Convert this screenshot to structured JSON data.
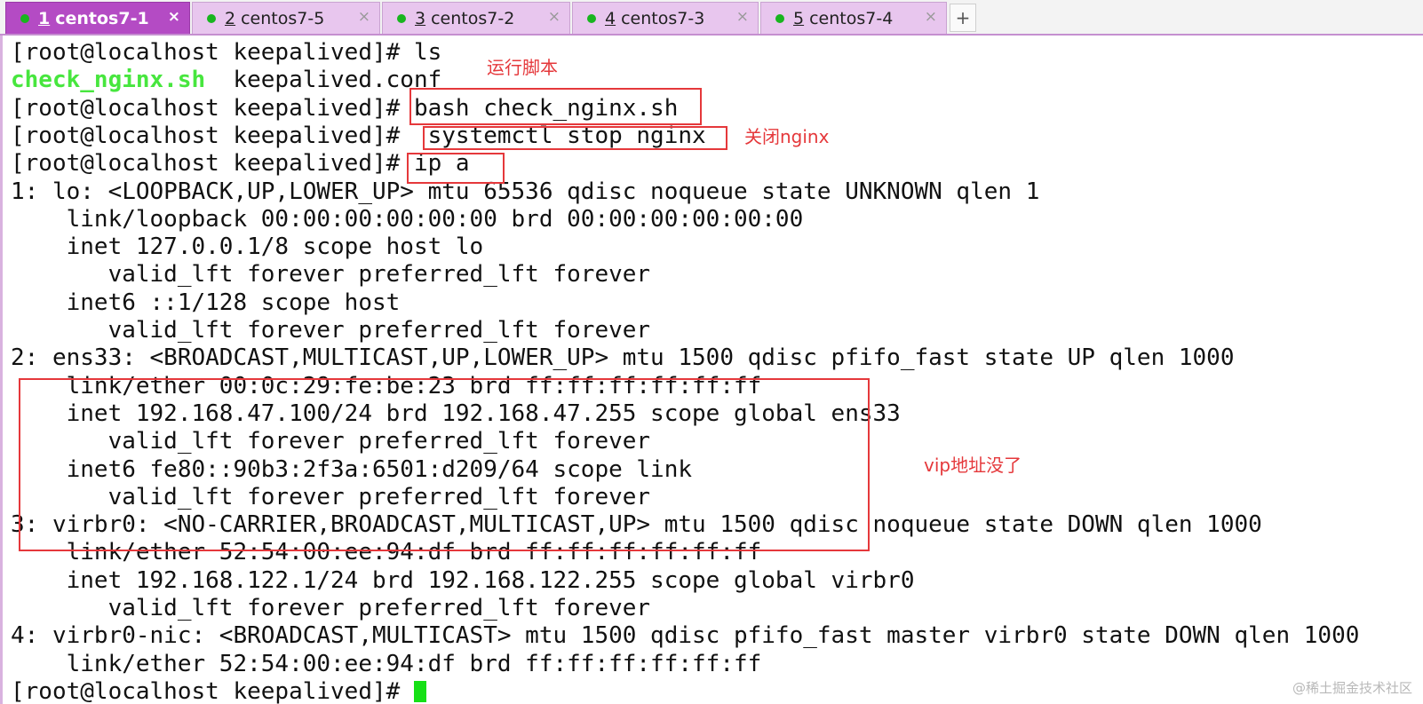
{
  "tabs": [
    {
      "num": "1",
      "label": "centos7-1",
      "active": true
    },
    {
      "num": "2",
      "label": "centos7-5",
      "active": false
    },
    {
      "num": "3",
      "label": "centos7-2",
      "active": false
    },
    {
      "num": "4",
      "label": "centos7-3",
      "active": false
    },
    {
      "num": "5",
      "label": "centos7-4",
      "active": false
    }
  ],
  "tab_close_glyph": "×",
  "tab_add_glyph": "+",
  "terminal": {
    "lines": [
      {
        "prompt": "[root@localhost keepalived]# ",
        "text": "ls"
      },
      {
        "green": "check_nginx.sh",
        "text": "  keepalived.conf"
      },
      {
        "prompt": "[root@localhost keepalived]# ",
        "text": "bash check_nginx.sh"
      },
      {
        "prompt": "[root@localhost keepalived]# ",
        "text": " systemctl stop nginx"
      },
      {
        "prompt": "[root@localhost keepalived]# ",
        "text": "ip a"
      },
      {
        "text": "1: lo: <LOOPBACK,UP,LOWER_UP> mtu 65536 qdisc noqueue state UNKNOWN qlen 1"
      },
      {
        "text": "    link/loopback 00:00:00:00:00:00 brd 00:00:00:00:00:00"
      },
      {
        "text": "    inet 127.0.0.1/8 scope host lo"
      },
      {
        "text": "       valid_lft forever preferred_lft forever"
      },
      {
        "text": "    inet6 ::1/128 scope host"
      },
      {
        "text": "       valid_lft forever preferred_lft forever"
      },
      {
        "text": "2: ens33: <BROADCAST,MULTICAST,UP,LOWER_UP> mtu 1500 qdisc pfifo_fast state UP qlen 1000"
      },
      {
        "text": "    link/ether 00:0c:29:fe:be:23 brd ff:ff:ff:ff:ff:ff"
      },
      {
        "text": "    inet 192.168.47.100/24 brd 192.168.47.255 scope global ens33"
      },
      {
        "text": "       valid_lft forever preferred_lft forever"
      },
      {
        "text": "    inet6 fe80::90b3:2f3a:6501:d209/64 scope link"
      },
      {
        "text": "       valid_lft forever preferred_lft forever"
      },
      {
        "text": "3: virbr0: <NO-CARRIER,BROADCAST,MULTICAST,UP> mtu 1500 qdisc noqueue state DOWN qlen 1000"
      },
      {
        "text": "    link/ether 52:54:00:ee:94:df brd ff:ff:ff:ff:ff:ff"
      },
      {
        "text": "    inet 192.168.122.1/24 brd 192.168.122.255 scope global virbr0"
      },
      {
        "text": "       valid_lft forever preferred_lft forever"
      },
      {
        "text": "4: virbr0-nic: <BROADCAST,MULTICAST> mtu 1500 qdisc pfifo_fast master virbr0 state DOWN qlen 1000"
      },
      {
        "text": "    link/ether 52:54:00:ee:94:df brd ff:ff:ff:ff:ff:ff"
      },
      {
        "prompt": "[root@localhost keepalived]# ",
        "text": "",
        "cursor": true
      }
    ]
  },
  "annotations": {
    "run_script": "运行脚本",
    "stop_nginx": "关闭nginx",
    "vip_gone": "vip地址没了"
  },
  "watermark": "@稀土掘金技术社区",
  "colors": {
    "accent": "#b44bc4",
    "annotation_red": "#e5383b",
    "exec_green": "#47e63e",
    "status_dot": "#18b51f"
  }
}
